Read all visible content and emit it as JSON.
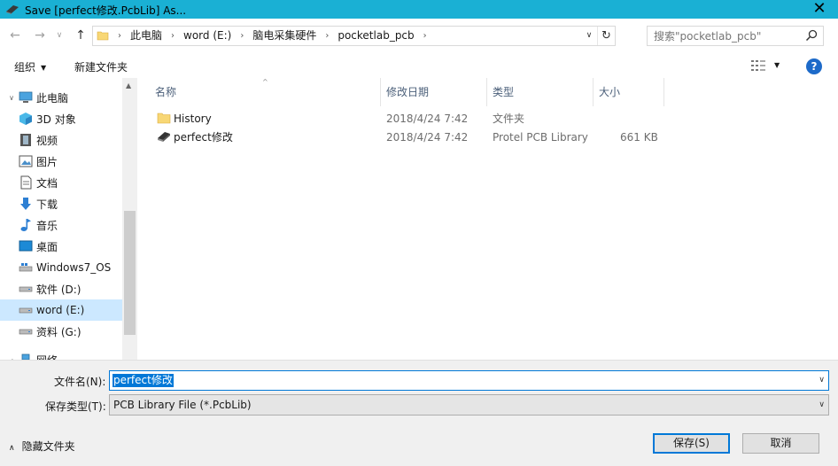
{
  "window": {
    "title": "Save [perfect修改.PcbLib] As..."
  },
  "address": {
    "crumbs": [
      "此电脑",
      "word (E:)",
      "脑电采集硬件",
      "pocketlab_pcb"
    ]
  },
  "search": {
    "placeholder": "搜索\"pocketlab_pcb\""
  },
  "toolbar": {
    "organize": "组织",
    "new_folder": "新建文件夹"
  },
  "nav": {
    "items": [
      {
        "label": "此电脑",
        "icon": "computer-icon"
      },
      {
        "label": "3D 对象",
        "icon": "cube-icon"
      },
      {
        "label": "视频",
        "icon": "video-icon"
      },
      {
        "label": "图片",
        "icon": "picture-icon"
      },
      {
        "label": "文档",
        "icon": "document-icon"
      },
      {
        "label": "下载",
        "icon": "download-icon"
      },
      {
        "label": "音乐",
        "icon": "music-icon"
      },
      {
        "label": "桌面",
        "icon": "desktop-icon"
      },
      {
        "label": "Windows7_OS",
        "icon": "drive-icon"
      },
      {
        "label": "软件 (D:)",
        "icon": "drive-icon"
      },
      {
        "label": "word (E:)",
        "icon": "drive-icon"
      },
      {
        "label": "资料 (G:)",
        "icon": "drive-icon"
      },
      {
        "label": "网络",
        "icon": "network-icon"
      }
    ]
  },
  "columns": {
    "name": "名称",
    "date": "修改日期",
    "type": "类型",
    "size": "大小"
  },
  "files": [
    {
      "name": "History",
      "date": "2018/4/24 7:42",
      "type": "文件夹",
      "size": ""
    },
    {
      "name": "perfect修改",
      "date": "2018/4/24 7:42",
      "type": "Protel PCB Library",
      "size": "661 KB"
    }
  ],
  "form": {
    "filename_label": "文件名(N):",
    "filename_value": "perfect修改",
    "filetype_label": "保存类型(T):",
    "filetype_value": "PCB Library File (*.PcbLib)"
  },
  "footer": {
    "hide_folders": "隐藏文件夹",
    "save": "保存(S)",
    "cancel": "取消"
  },
  "colors": {
    "titlebar": "#1ab0d4",
    "accent": "#0078d7",
    "selection": "#cce8ff"
  }
}
